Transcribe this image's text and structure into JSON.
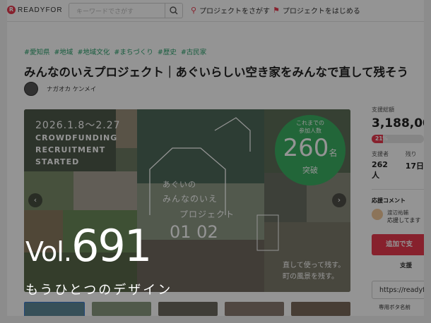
{
  "header": {
    "logo_mark": "R",
    "logo_text": "READYFOR",
    "search_placeholder": "キーワードでさがす",
    "nav_find": "プロジェクトをさがす",
    "nav_start": "プロジェクトをはじめる"
  },
  "project": {
    "tags": [
      "#愛知県",
      "#地域",
      "#地域文化",
      "#まちづくり",
      "#歴史",
      "#古民家"
    ],
    "title": "みんなのいえプロジェクト｜あぐいらしい空き家をみんなで直して残そう",
    "author": "ナガオカ ケンメイ"
  },
  "hero": {
    "date": "2026.1.8～2.27",
    "line1": "CROWDFUNDING",
    "line2": "RECRUITMENT",
    "line3": "STARTED",
    "circle_top": "これまでの",
    "circle_mid": "参加人数",
    "circle_num": "260",
    "circle_unit": "名",
    "circle_bottom": "突破",
    "agui": "あぐいの",
    "minna": "みんなのいえ",
    "proj": "プロジェクト",
    "nums": "01 02",
    "slogan1": "直して使って残す。",
    "slogan2": "町の風景を残す。",
    "prev": "‹",
    "next": "›"
  },
  "sidebar": {
    "total_label": "支援総額",
    "total_value": "3,188,00",
    "progress_label": "21%",
    "progress_fraction": 0.21,
    "supporters_label": "支援者",
    "supporters_value": "262人",
    "remaining_label": "残り",
    "remaining_value": "17日",
    "comments_label": "応援コメント",
    "commenter": "渡辺祐輔",
    "comment": "応援してます",
    "cta": "追加で支",
    "sub_link": "支援",
    "url": "https://readyfor",
    "bottom_link": "専用ボタ名前"
  },
  "overlay": {
    "vol_prefix": "Vol.",
    "vol_number": "691",
    "subtitle": "もうひとつのデザイン"
  },
  "colors": {
    "accent": "#e8394f",
    "tag": "#2aa06c",
    "circle": "#3bb062"
  }
}
